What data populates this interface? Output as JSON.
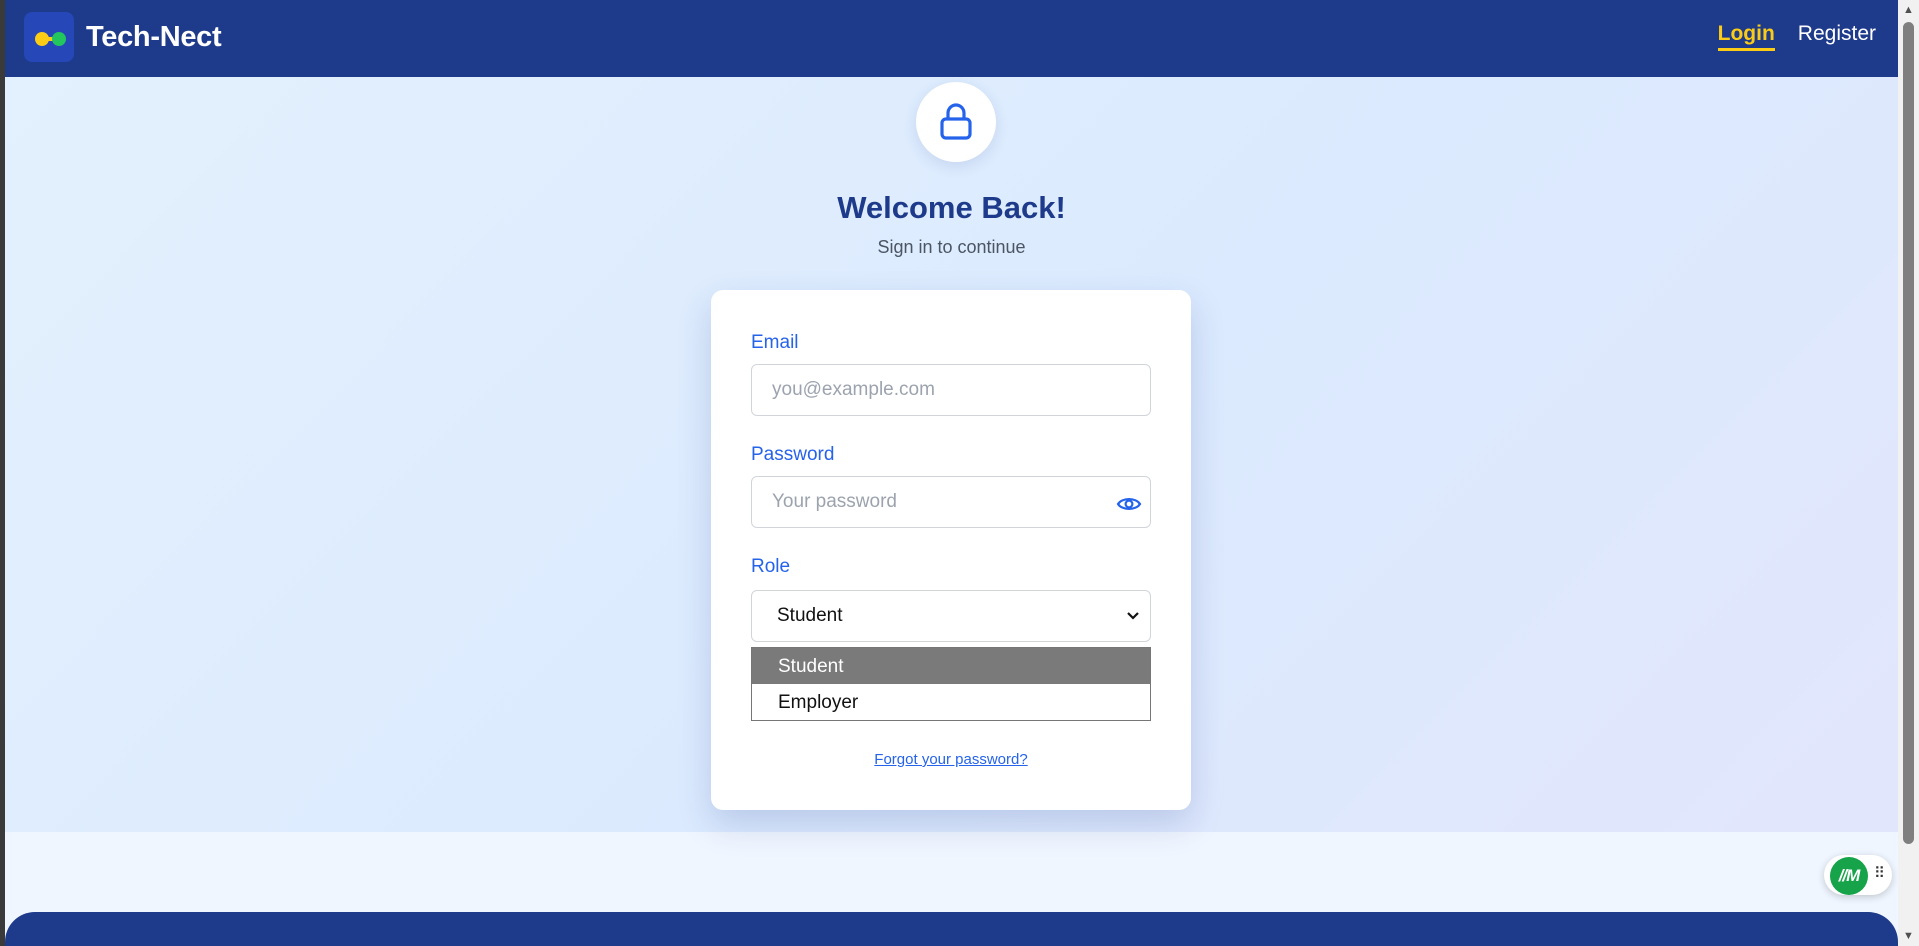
{
  "navbar": {
    "brand": "Tech-Nect",
    "links": {
      "login": "Login",
      "register": "Register"
    }
  },
  "login": {
    "title": "Welcome Back!",
    "subtitle": "Sign in to continue",
    "email": {
      "label": "Email",
      "placeholder": "you@example.com",
      "value": ""
    },
    "password": {
      "label": "Password",
      "placeholder": "Your password",
      "value": ""
    },
    "role": {
      "label": "Role",
      "selected": "Student",
      "options": [
        "Student",
        "Employer"
      ]
    },
    "forgot_link": "Forgot your password?"
  },
  "widget": {
    "label": "//M"
  },
  "colors": {
    "navbar": "#1e3a8a",
    "accent": "#facc15",
    "primary": "#2563eb",
    "widget": "#16a34a"
  },
  "icons": [
    "lock-icon",
    "eye-icon",
    "chevron-down-icon",
    "drag-handle-icon"
  ]
}
